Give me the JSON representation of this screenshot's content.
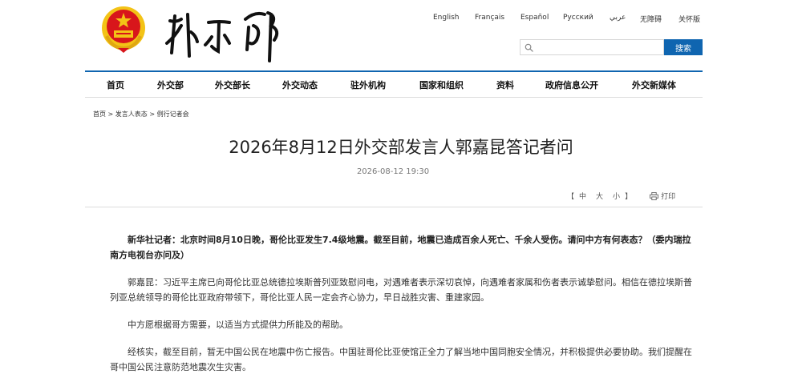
{
  "languages": [
    "English",
    "Français",
    "Español",
    "Русский",
    "عربي",
    "无障碍",
    "关怀版"
  ],
  "search": {
    "button_label": "搜索",
    "placeholder": ""
  },
  "nav": [
    "首页",
    "外交部",
    "外交部长",
    "外交动态",
    "驻外机构",
    "国家和组织",
    "资料",
    "政府信息公开",
    "外交新媒体"
  ],
  "breadcrumb": {
    "home": "首页",
    "sep": " > ",
    "section": "发言人表态",
    "current": "例行记者会"
  },
  "article": {
    "title": "2026年8月12日外交部发言人郭嘉昆答记者问",
    "date": "2026-08-12 19:30",
    "font_bracket_open": "【",
    "font_large": "中",
    "font_medium": "大",
    "font_small": "小",
    "font_bracket_close": "】",
    "print_label": "打印",
    "paragraphs": [
      "新华社记者：北京时间8月10日晚，哥伦比亚发生7.4级地震。截至目前，地震已造成百余人死亡、千余人受伤。请问中方有何表态？（委内瑞拉南方电视台亦问及）",
      "郭嘉昆：习近平主席已向哥伦比亚总统德拉埃斯普列亚致慰问电，对遇难者表示深切哀悼，向遇难者家属和伤者表示诚挚慰问。相信在德拉埃斯普列亚总统领导的哥伦比亚政府带领下，哥伦比亚人民一定会齐心协力，早日战胜灾害、重建家园。",
      "中方愿根据哥方需要，以适当方式提供力所能及的帮助。",
      "经核实，截至目前，暂无中国公民在地震中伤亡报告。中国驻哥伦比亚使馆正全力了解当地中国同胞安全情况，并积极提供必要协助。我们提醒在哥中国公民注意防范地震次生灾害。"
    ]
  },
  "colors": {
    "accent": "#0f65b0",
    "emblem_red": "#d8161b",
    "emblem_gold": "#f3c316"
  },
  "icons": {
    "emblem": "national-emblem-icon",
    "search": "search-icon",
    "print": "printer-icon"
  }
}
